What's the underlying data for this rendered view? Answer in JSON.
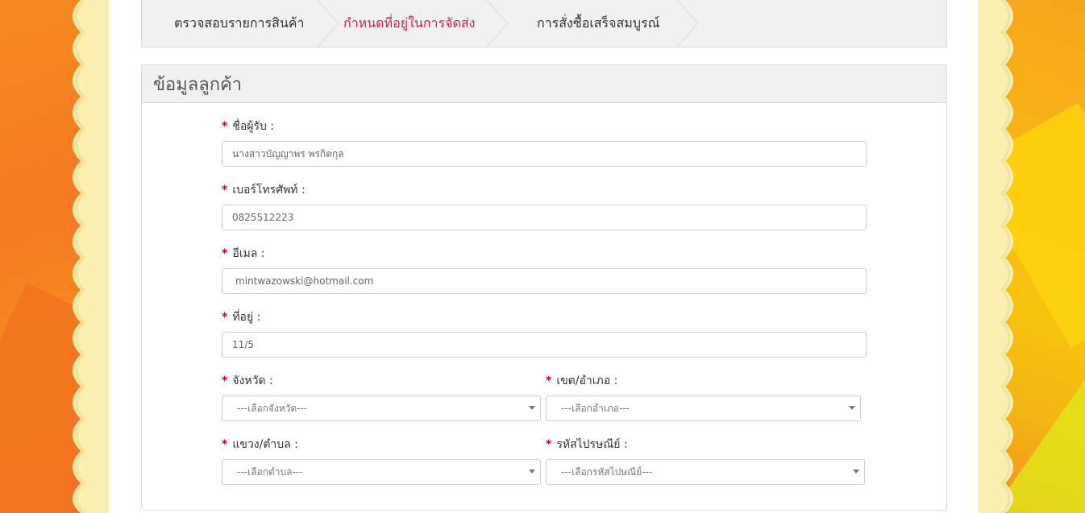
{
  "steps": {
    "step1": "ตรวจสอบรายการสินค้า",
    "step2": "กำหนดที่อยู่ในการจัดส่ง",
    "step3": "การสั่งซื้อเสร็จสมบูรณ์",
    "active_color": "#e2184c"
  },
  "panel": {
    "title": "ข้อมูลลูกค้า"
  },
  "form": {
    "required_mark": "*",
    "name_label": "ชื่อผู้รับ :",
    "name_value": "นางสาวบัญญาพร พรกิตกุล",
    "phone_label": "เบอร์โทรศัพท์ :",
    "phone_value": "0825512223",
    "email_label": "อีเมล :",
    "email_value": "mintwazowski@hotmail.com",
    "address_label": "ที่อยู่ :",
    "address_value": "11/5",
    "province_label": "จังหวัด :",
    "province_value": "---เลือกจังหวัด---",
    "district_label": "เขต/อำเภอ :",
    "district_value": "---เลือกอำเภอ---",
    "subdistrict_label": "แขวง/ตำบล :",
    "subdistrict_value": "---เลือกตำบล---",
    "postcode_label": "รหัสไปรษณีย์ :",
    "postcode_value": "---เลือกรหัสไปษณีย์---"
  }
}
